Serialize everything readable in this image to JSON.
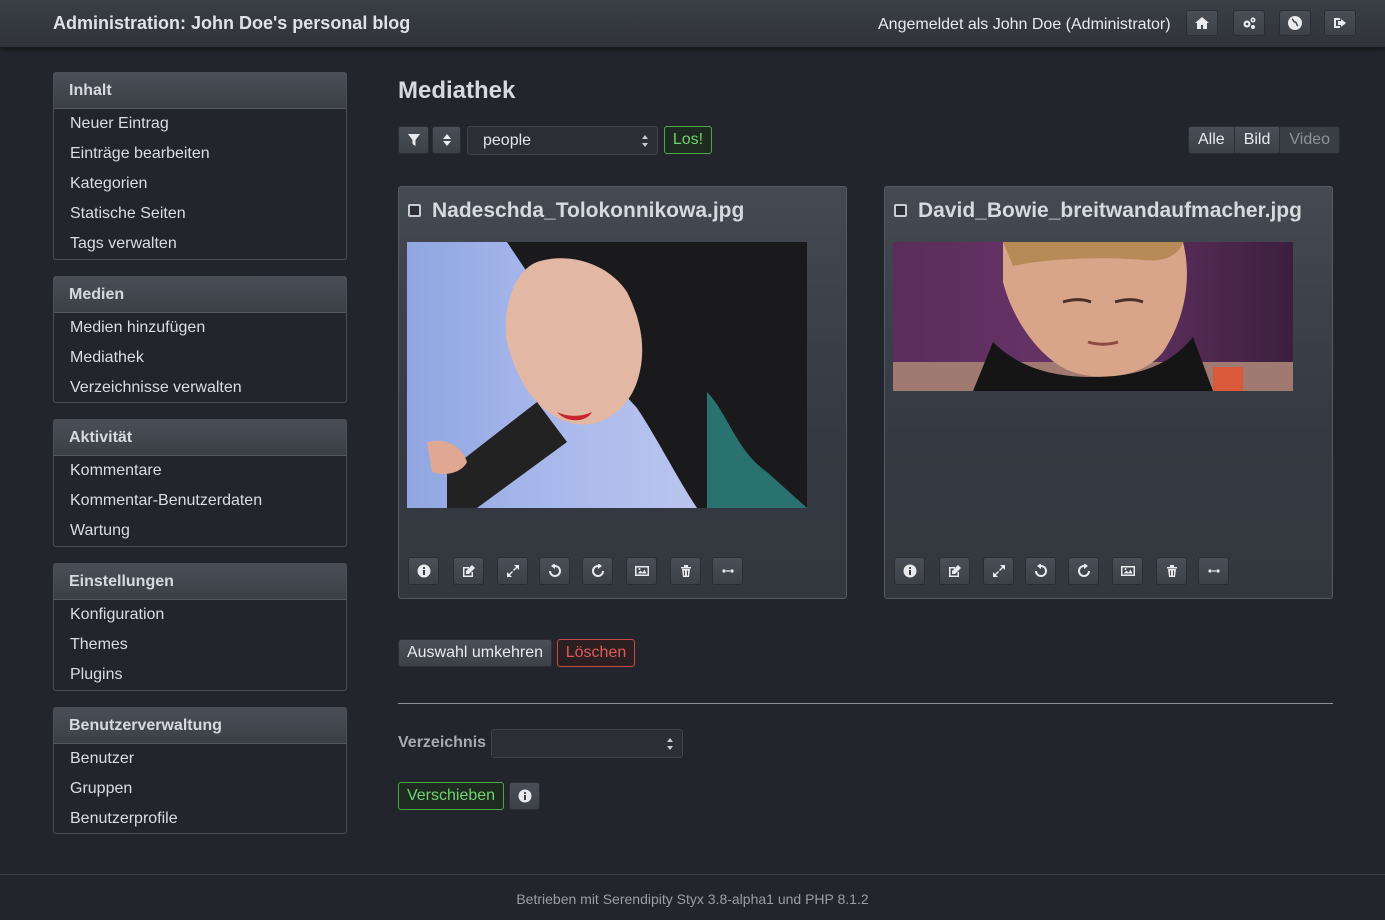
{
  "header": {
    "title": "Administration: John Doe's personal blog",
    "user": "Angemeldet als John Doe (Administrator)",
    "icons": [
      "home-icon",
      "settings-icon",
      "globe-icon",
      "logout-icon"
    ]
  },
  "sidebar": [
    {
      "heading": "Inhalt",
      "items": [
        "Neuer Eintrag",
        "Einträge bearbeiten",
        "Kategorien",
        "Statische Seiten",
        "Tags verwalten"
      ]
    },
    {
      "heading": "Medien",
      "items": [
        "Medien hinzufügen",
        "Mediathek",
        "Verzeichnisse verwalten"
      ]
    },
    {
      "heading": "Aktivität",
      "items": [
        "Kommentare",
        "Kommentar-Benutzerdaten",
        "Wartung"
      ]
    },
    {
      "heading": "Einstellungen",
      "items": [
        "Konfiguration",
        "Themes",
        "Plugins"
      ]
    },
    {
      "heading": "Benutzerverwaltung",
      "items": [
        "Benutzer",
        "Gruppen",
        "Benutzerprofile"
      ]
    }
  ],
  "main": {
    "title": "Mediathek",
    "filter_value": "people",
    "go_label": "Los!",
    "type_filter": [
      "Alle",
      "Bild",
      "Video"
    ],
    "media": [
      {
        "filename": "Nadeschda_Tolokonnikowa.jpg"
      },
      {
        "filename": "David_Bowie_breitwandaufmacher.jpg"
      }
    ],
    "tools": [
      "info-icon",
      "edit-icon",
      "resize-icon",
      "rotate-left-icon",
      "rotate-right-icon",
      "image-icon",
      "delete-icon",
      "link-icon"
    ],
    "invert_label": "Auswahl umkehren",
    "delete_label": "Löschen",
    "directory_label": "Verzeichnis",
    "directory_value": "",
    "move_label": "Verschieben"
  },
  "footer": {
    "text": "Betrieben mit Serendipity Styx 3.8-alpha1 und PHP 8.1.2"
  },
  "colors": {
    "background": "#22252b",
    "panel": "#3b3f46",
    "accent_green": "#6ed36e",
    "danger": "#e05a5a"
  }
}
